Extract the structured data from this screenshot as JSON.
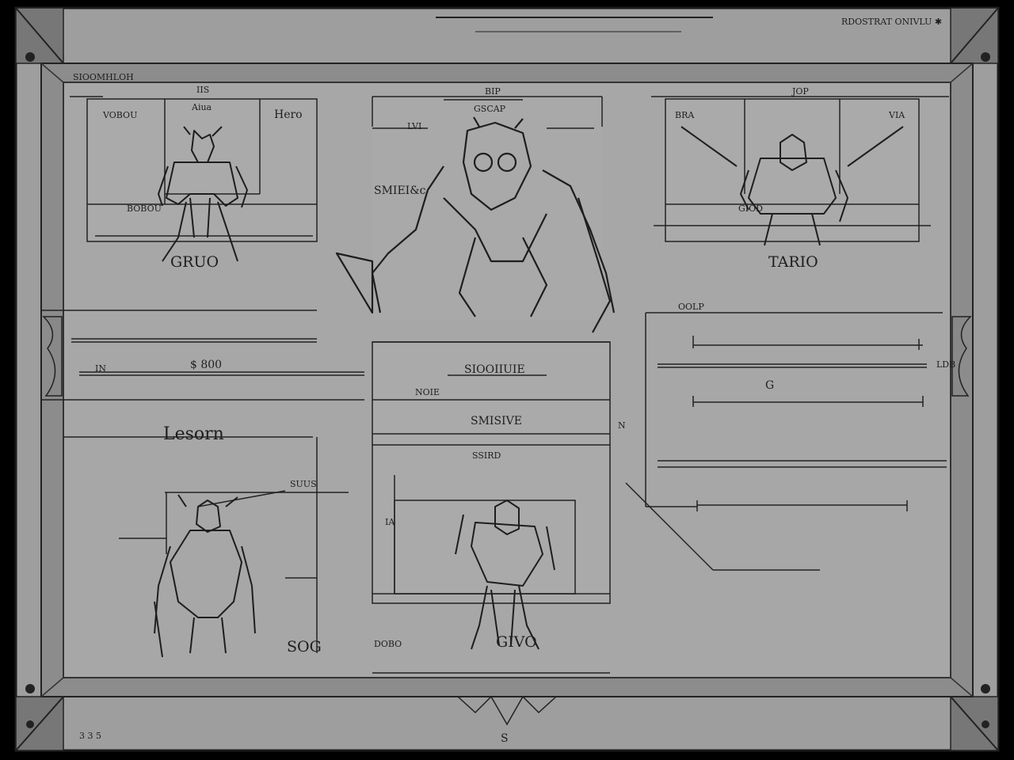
{
  "sheet": {
    "title_text": "RDOSTRAT ONIVLU ✱",
    "header_left_text": "SIOOMHLOH",
    "footer_left_text": "3 3 5",
    "footer_center_text": "S"
  },
  "panels": {
    "top_left": {
      "header": "IIS",
      "tag": "VOBOU",
      "sublabel": "Aiua",
      "corner_label": "Hero",
      "side_label": "BOBOU",
      "caption": "GRUO"
    },
    "top_center": {
      "header": "BIP",
      "sublabel": "GSCAP",
      "side_label": "SMIEI&c",
      "tick_label": "LVI"
    },
    "top_right": {
      "header": "JOP",
      "left_tag": "BRA",
      "right_tag": "VIA",
      "side_label": "GIOD",
      "caption": "TARIO"
    },
    "middle": {
      "left_value": "$ 800",
      "left_small_tag": "IN",
      "center_title": "SIOOIIUIE",
      "center_small_tag": "NOIE",
      "center_heading": "SMISIVE",
      "center_sub": "SSIRD",
      "right_tag": "OOLP",
      "right_small_tag": "LDB",
      "right_mark": "G"
    },
    "bottom_left": {
      "title": "Lesorn",
      "tag": "SUUS",
      "caption": "SOG"
    },
    "bottom_center": {
      "tag": "IA",
      "caption": "GIVO",
      "left_caption": "DOBO"
    },
    "bottom_right": {
      "mark": "N"
    }
  },
  "colors": {
    "frame_outer": "#000000",
    "sheet_bg": "#a6a6a6",
    "border_band": "#8d8d8d",
    "ink": "#1e1e1e",
    "panel_bg": "#a9a9a9"
  }
}
